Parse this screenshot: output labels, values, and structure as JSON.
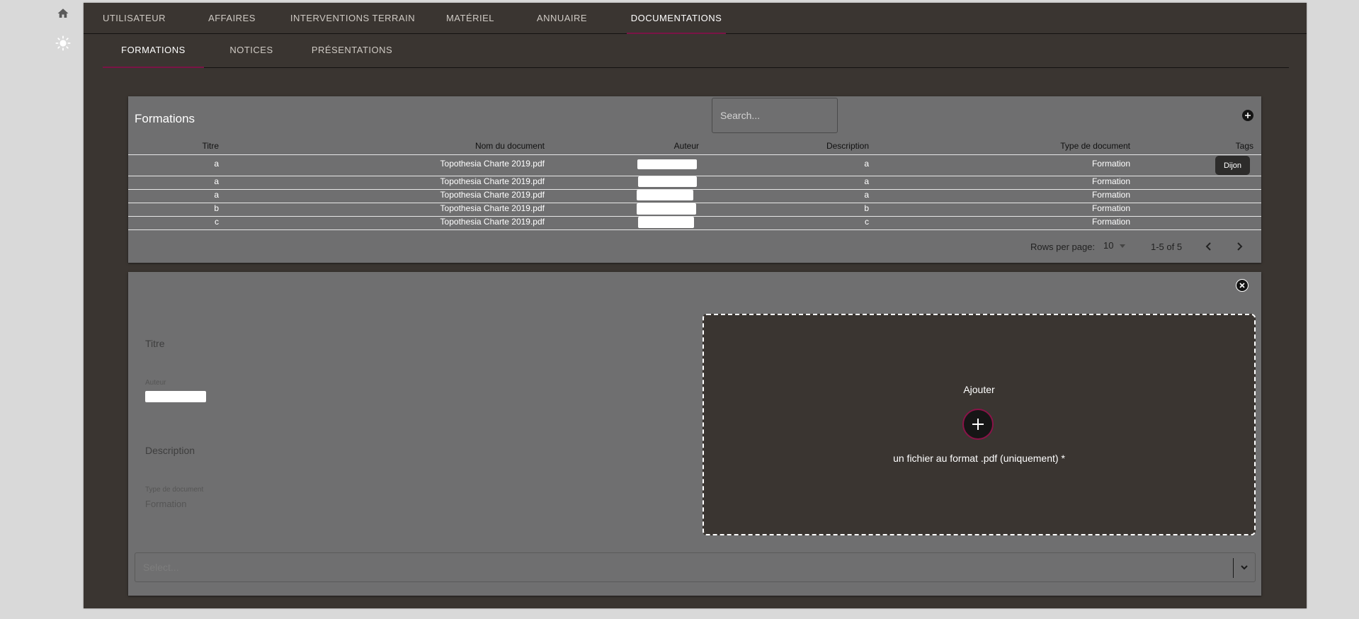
{
  "sidebar": {
    "icons": [
      "home-icon",
      "sun-icon"
    ]
  },
  "nav": {
    "tabs": [
      {
        "label": "UTILISATEUR"
      },
      {
        "label": "AFFAIRES"
      },
      {
        "label": "INTERVENTIONS TERRAIN"
      },
      {
        "label": "MATÉRIEL"
      },
      {
        "label": "ANNUAIRE"
      },
      {
        "label": "DOCUMENTATIONS",
        "active": true
      }
    ],
    "subtabs": [
      {
        "label": "FORMATIONS",
        "active": true
      },
      {
        "label": "NOTICES"
      },
      {
        "label": "PRÉSENTATIONS"
      }
    ]
  },
  "table": {
    "title": "Formations",
    "search_placeholder": "Search...",
    "columns": [
      "Titre",
      "Nom du document",
      "Auteur",
      "Description",
      "Type de document",
      "Tags"
    ],
    "rows": [
      {
        "titre": "a",
        "nom": "Topothesia Charte 2019.pdf",
        "description": "a",
        "type": "Formation",
        "tag": "Dijon"
      },
      {
        "titre": "a",
        "nom": "Topothesia Charte 2019.pdf",
        "description": "a",
        "type": "Formation",
        "tag": ""
      },
      {
        "titre": "a",
        "nom": "Topothesia Charte 2019.pdf",
        "description": "a",
        "type": "Formation",
        "tag": ""
      },
      {
        "titre": "b",
        "nom": "Topothesia Charte 2019.pdf",
        "description": "b",
        "type": "Formation",
        "tag": ""
      },
      {
        "titre": "c",
        "nom": "Topothesia Charte 2019.pdf",
        "description": "c",
        "type": "Formation",
        "tag": ""
      }
    ],
    "pagination": {
      "rows_label": "Rows per page:",
      "rows_value": "10",
      "range": "1-5 of 5"
    }
  },
  "form": {
    "titre_label": "Titre",
    "auteur_label": "Auteur",
    "description_label": "Description",
    "type_label": "Type de document",
    "type_value": "Formation",
    "dropzone": {
      "title": "Ajouter",
      "subtitle": "un fichier au format .pdf (uniquement) *"
    },
    "select_placeholder": "Select..."
  }
}
